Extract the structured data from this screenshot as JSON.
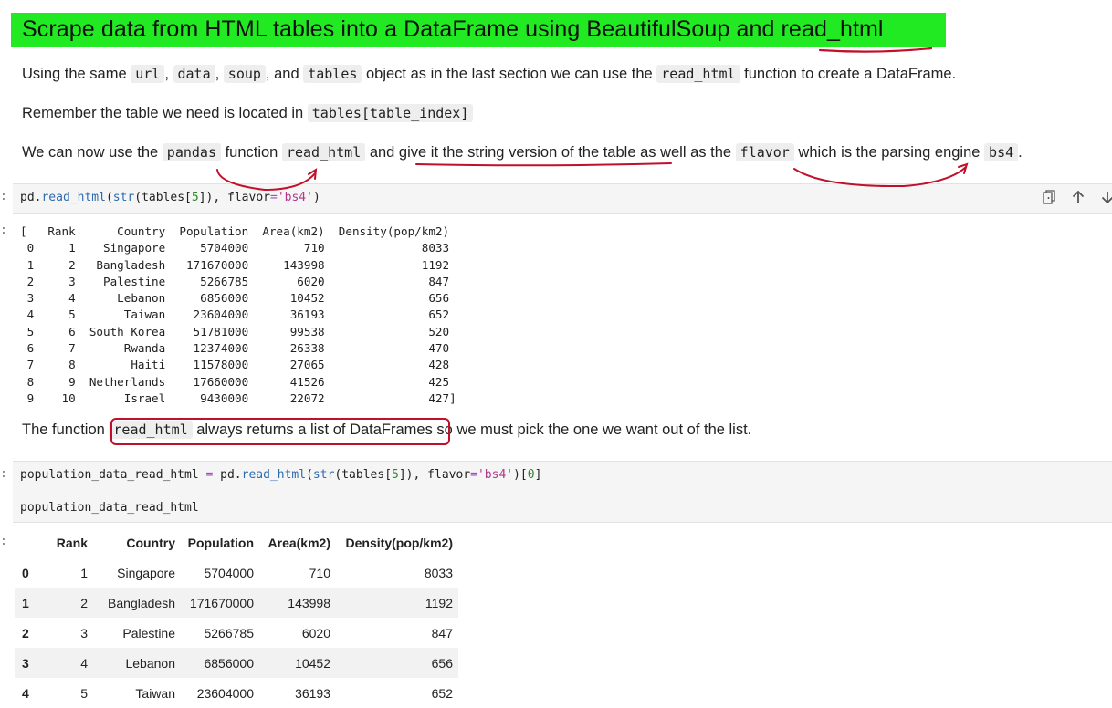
{
  "title": "Scrape data from HTML tables into a DataFrame using BeautifulSoup and read_html",
  "para1": {
    "t1": "Using the same ",
    "c1": "url",
    "t2": ", ",
    "c2": "data",
    "t3": ", ",
    "c3": "soup",
    "t4": ", and ",
    "c4": "tables",
    "t5": " object as in the last section we can use the ",
    "c5": "read_html",
    "t6": " function to create a DataFrame."
  },
  "para2": {
    "t1": "Remember the table we need is located in ",
    "c1": "tables[table_index]"
  },
  "para3": {
    "t1": "We can now use the ",
    "c1": "pandas",
    "t2": " function ",
    "c2": "read_html",
    "t3": " and give it the string version of the table as well as the ",
    "c3": "flavor",
    "t4": " which is the parsing engine ",
    "c4": "bs4",
    "t5": "."
  },
  "cell1": {
    "prompt": ":",
    "p1": "pd.",
    "fn": "read_html",
    "p2": "(",
    "bi": "str",
    "p3": "(tables[",
    "n": "5",
    "p4": "]), flavor",
    "eq": "=",
    "s": "'bs4'",
    "p5": ")"
  },
  "output1": {
    "prompt": ":",
    "text": "[   Rank      Country  Population  Area(km2)  Density(pop/km2)\n 0     1    Singapore     5704000        710              8033\n 1     2   Bangladesh   171670000     143998              1192\n 2     3    Palestine     5266785       6020               847\n 3     4      Lebanon     6856000      10452               656\n 4     5       Taiwan    23604000      36193               652\n 5     6  South Korea    51781000      99538               520\n 6     7       Rwanda    12374000      26338               470\n 7     8        Haiti    11578000      27065               428\n 8     9  Netherlands    17660000      41526               425\n 9    10       Israel     9430000      22072               427]"
  },
  "para4": {
    "t1": "The function ",
    "c1": "read_html",
    "t2": " always returns a list of DataFrames",
    "t3": " so we must pick the one we want out of the list."
  },
  "cell2": {
    "prompt": ":",
    "line1_a": "population_data_read_html ",
    "line1_eq": "=",
    "line1_b": " pd.",
    "line1_fn": "read_html",
    "line1_c": "(",
    "line1_bi": "str",
    "line1_d": "(tables[",
    "line1_n": "5",
    "line1_e": "]), flavor",
    "line1_eq2": "=",
    "line1_s": "'bs4'",
    "line1_f": ")[",
    "line1_n2": "0",
    "line1_g": "]",
    "line2": "population_data_read_html"
  },
  "output2": {
    "prompt": ":",
    "columns": [
      "",
      "Rank",
      "Country",
      "Population",
      "Area(km2)",
      "Density(pop/km2)"
    ],
    "rows": [
      [
        "0",
        "1",
        "Singapore",
        "5704000",
        "710",
        "8033"
      ],
      [
        "1",
        "2",
        "Bangladesh",
        "171670000",
        "143998",
        "1192"
      ],
      [
        "2",
        "3",
        "Palestine",
        "5266785",
        "6020",
        "847"
      ],
      [
        "3",
        "4",
        "Lebanon",
        "6856000",
        "10452",
        "656"
      ],
      [
        "4",
        "5",
        "Taiwan",
        "23604000",
        "36193",
        "652"
      ]
    ]
  },
  "toolbar": {
    "copy_icon": "copy-icon",
    "up_icon": "arrow-up-icon",
    "down_icon": "arrow-down-icon"
  },
  "colors": {
    "title_highlight": "#22ea22",
    "annotation": "#c0102a"
  }
}
